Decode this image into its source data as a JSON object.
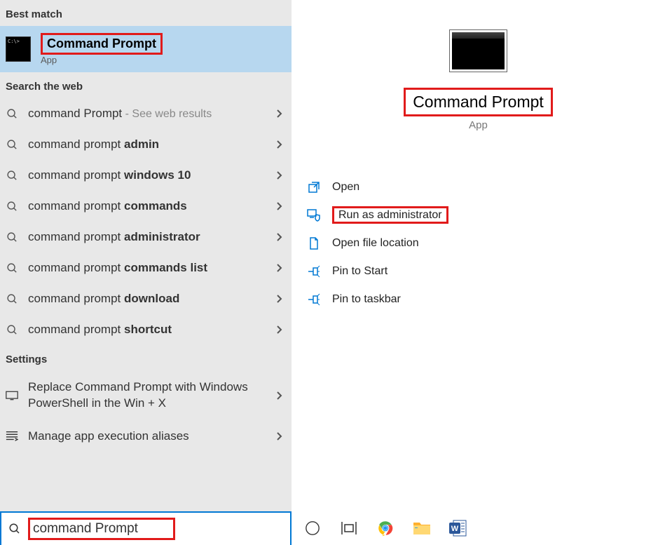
{
  "leftPane": {
    "bestMatchHeader": "Best match",
    "bestMatch": {
      "title": "Command Prompt",
      "sub": "App"
    },
    "webHeader": "Search the web",
    "webItems": [
      {
        "prefix": "command Prompt",
        "bold": "",
        "suffix": " - See web results"
      },
      {
        "prefix": "command prompt ",
        "bold": "admin",
        "suffix": ""
      },
      {
        "prefix": "command prompt ",
        "bold": "windows 10",
        "suffix": ""
      },
      {
        "prefix": "command prompt ",
        "bold": "commands",
        "suffix": ""
      },
      {
        "prefix": "command prompt ",
        "bold": "administrator",
        "suffix": ""
      },
      {
        "prefix": "command prompt ",
        "bold": "commands list",
        "suffix": ""
      },
      {
        "prefix": "command prompt ",
        "bold": "download",
        "suffix": ""
      },
      {
        "prefix": "command prompt ",
        "bold": "shortcut",
        "suffix": ""
      }
    ],
    "settingsHeader": "Settings",
    "settings": [
      {
        "line1": "Replace ",
        "bold": "Command Prompt",
        "line2": " with Windows PowerShell in the Win + X"
      },
      {
        "line1": "Manage app execution aliases",
        "bold": "",
        "line2": ""
      }
    ]
  },
  "searchBar": {
    "text": "command Prompt"
  },
  "preview": {
    "title": "Command Prompt",
    "sub": "App",
    "actions": [
      {
        "label": "Open",
        "icon": "open"
      },
      {
        "label": "Run as administrator",
        "icon": "admin",
        "highlight": true
      },
      {
        "label": "Open file location",
        "icon": "folder"
      },
      {
        "label": "Pin to Start",
        "icon": "pin"
      },
      {
        "label": "Pin to taskbar",
        "icon": "pin"
      }
    ]
  }
}
